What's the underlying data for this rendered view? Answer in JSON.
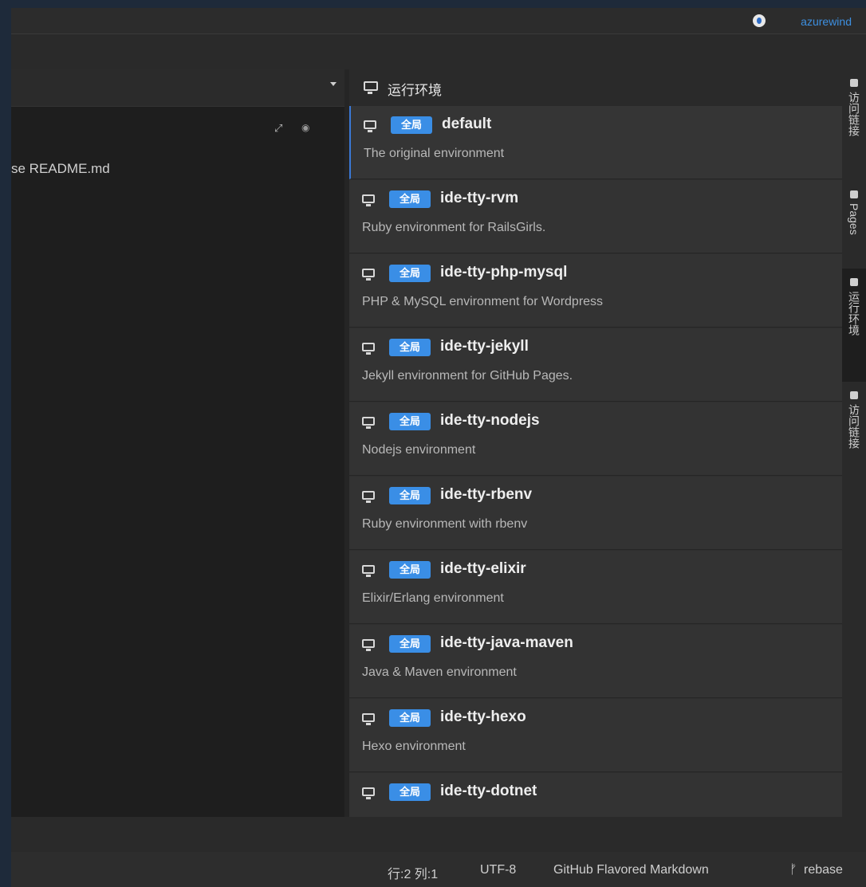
{
  "user": {
    "name": "azurewind"
  },
  "editor": {
    "visible_text": "se README.md"
  },
  "panel": {
    "title": "运行环境",
    "badge_label": "全局",
    "environments": [
      {
        "name": "default",
        "description": "The original environment",
        "active": true
      },
      {
        "name": "ide-tty-rvm",
        "description": "Ruby environment for RailsGirls."
      },
      {
        "name": "ide-tty-php-mysql",
        "description": "PHP & MySQL environment for Wordpress"
      },
      {
        "name": "ide-tty-jekyll",
        "description": "Jekyll environment for GitHub Pages."
      },
      {
        "name": "ide-tty-nodejs",
        "description": "Nodejs environment"
      },
      {
        "name": "ide-tty-rbenv",
        "description": "Ruby environment with rbenv"
      },
      {
        "name": "ide-tty-elixir",
        "description": "Elixir/Erlang environment"
      },
      {
        "name": "ide-tty-java-maven",
        "description": "Java & Maven environment"
      },
      {
        "name": "ide-tty-hexo",
        "description": "Hexo environment"
      },
      {
        "name": "ide-tty-dotnet",
        "description": ""
      }
    ]
  },
  "right_tabs": [
    {
      "label": "访问链接",
      "icon": "link-icon"
    },
    {
      "label": "Pages",
      "icon": "pages-icon"
    },
    {
      "label": "运行环境",
      "icon": "monitor-icon",
      "active": true
    },
    {
      "label": "访问链接",
      "icon": "edit-icon"
    }
  ],
  "status_bar": {
    "position": "行:2 列:1",
    "encoding": "UTF-8",
    "language": "GitHub Flavored Markdown",
    "branch": "rebase"
  }
}
